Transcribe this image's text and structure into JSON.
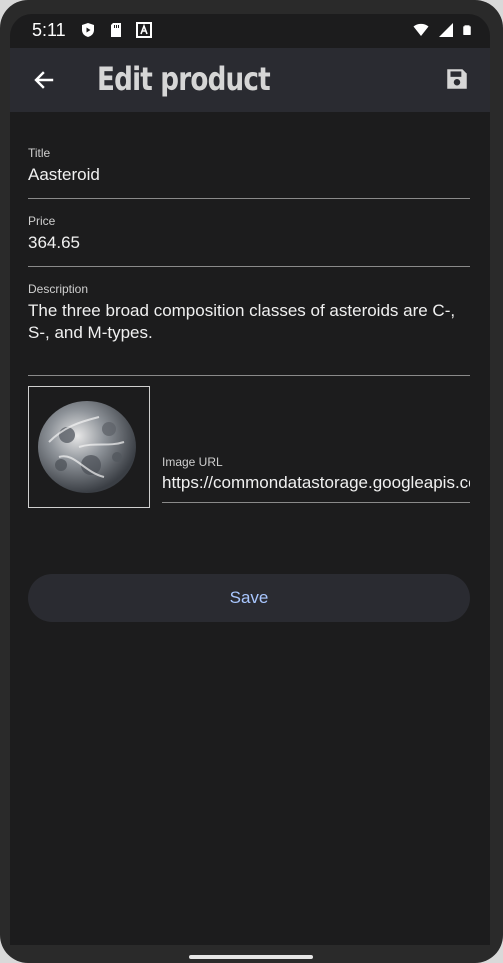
{
  "status_bar": {
    "time": "5:11",
    "left_icons": [
      "shield-play-icon",
      "sd-card-icon",
      "font-a-icon"
    ],
    "right_icons": [
      "wifi-icon",
      "signal-icon",
      "battery-icon"
    ]
  },
  "app_bar": {
    "title": "Edit product",
    "back_icon": "arrow-back-icon",
    "action_icon": "save-floppy-icon"
  },
  "form": {
    "title": {
      "label": "Title",
      "value": "Aasteroid"
    },
    "price": {
      "label": "Price",
      "value": "364.65"
    },
    "description": {
      "label": "Description",
      "value": "The three broad composition classes of asteroids are C-, S-, and M-types."
    },
    "image_url": {
      "label": "Image URL",
      "value": "https://commondatastorage.googleapis.co"
    }
  },
  "save_button": {
    "label": "Save"
  },
  "colors": {
    "background": "#1c1c1d",
    "app_bar": "#2a2b31",
    "button_text": "#a9c7ff",
    "title_text": "#d6d6d6"
  }
}
